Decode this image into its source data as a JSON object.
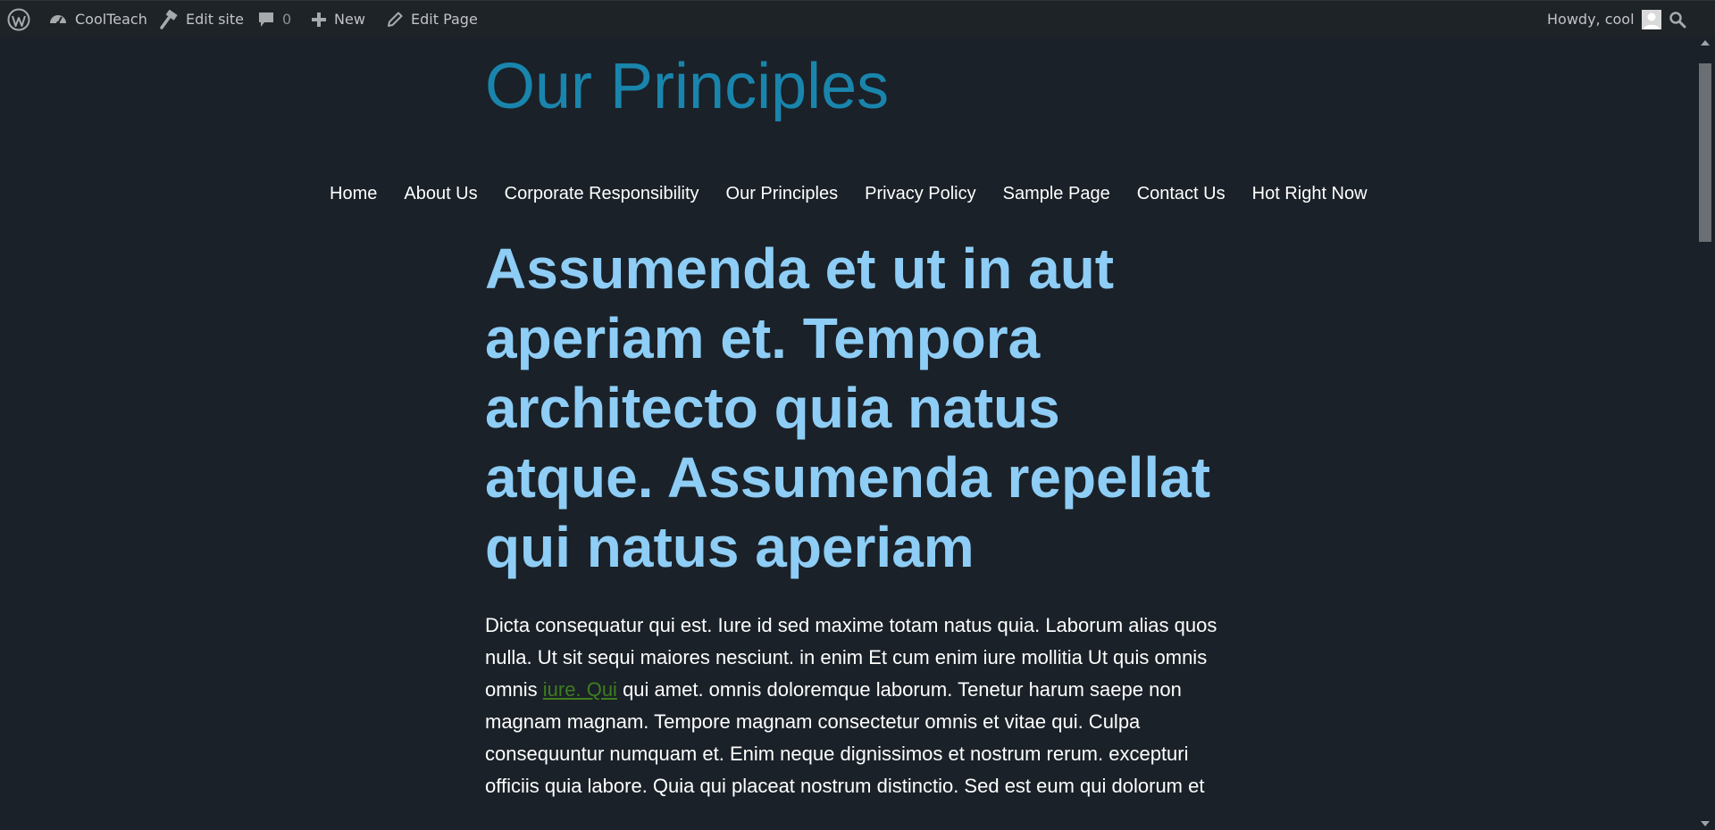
{
  "admin_bar": {
    "site_name": "CoolTeach",
    "edit_site": "Edit site",
    "comments_count": "0",
    "new_label": "New",
    "edit_page": "Edit Page",
    "howdy": "Howdy, cool"
  },
  "site": {
    "title": "Our Principles"
  },
  "nav": {
    "items": [
      {
        "label": "Home"
      },
      {
        "label": "About Us"
      },
      {
        "label": "Corporate Responsibility"
      },
      {
        "label": "Our Principles"
      },
      {
        "label": "Privacy Policy"
      },
      {
        "label": "Sample Page"
      },
      {
        "label": "Contact Us"
      },
      {
        "label": "Hot Right Now"
      }
    ]
  },
  "post": {
    "headline": "Assumenda et ut in aut aperiam et. Tempora architecto quia natus atque. Assumenda repellat qui natus aperiam",
    "para_before": "Dicta consequatur qui est. Iure id sed maxime totam natus quia. Laborum alias quos nulla. Ut sit sequi maiores nesciunt. in enim Et cum enim iure mollitia Ut quis omnis omnis ",
    "link_text": "iure. Qui",
    "para_after": " qui amet. omnis doloremque laborum. Tenetur harum saepe non magnam magnam. Tempore magnam consectetur omnis et vitae qui. Culpa consequuntur numquam et. Enim neque dignissimos et nostrum rerum. excepturi officiis quia labore. Quia qui placeat nostrum distinctio. Sed est eum qui dolorum et"
  },
  "colors": {
    "background": "#1a2128",
    "admin_bar": "#1d2327",
    "site_title": "#1985ad",
    "headline": "#8ecdf5",
    "link": "#3f7d1f"
  }
}
